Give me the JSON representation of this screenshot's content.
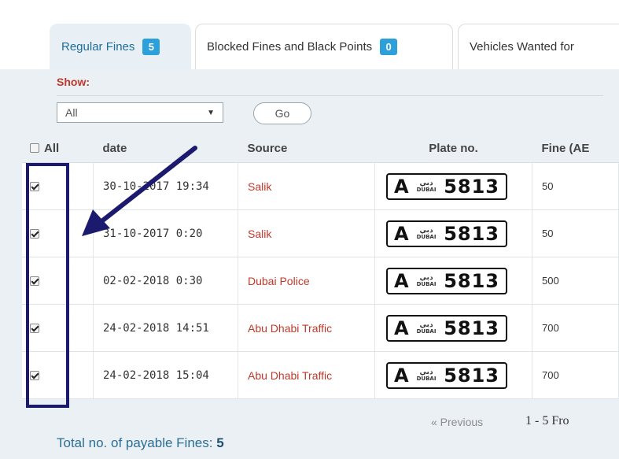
{
  "tabs": [
    {
      "label": "Regular Fines",
      "badge": "5",
      "active": true
    },
    {
      "label": "Blocked Fines and Black Points",
      "badge": "0",
      "active": false
    },
    {
      "label": "Vehicles Wanted for",
      "badge": "",
      "active": false
    }
  ],
  "filter": {
    "show_label": "Show:",
    "select_value": "All",
    "go_label": "Go"
  },
  "table": {
    "headers": {
      "all": "All",
      "date": "date",
      "source": "Source",
      "plate": "Plate no.",
      "fine": "Fine (AE"
    },
    "rows": [
      {
        "date": "30-10-2017 19:34",
        "source": "Salik",
        "plate": {
          "code": "A",
          "emirate_ar": "دبي",
          "emirate_en": "DUBAI",
          "number": "5813"
        },
        "fine": "50",
        "checked": true
      },
      {
        "date": "31-10-2017 0:20",
        "source": "Salik",
        "plate": {
          "code": "A",
          "emirate_ar": "دبي",
          "emirate_en": "DUBAI",
          "number": "5813"
        },
        "fine": "50",
        "checked": true
      },
      {
        "date": "02-02-2018 0:30",
        "source": "Dubai Police",
        "plate": {
          "code": "A",
          "emirate_ar": "دبي",
          "emirate_en": "DUBAI",
          "number": "5813"
        },
        "fine": "500",
        "checked": true
      },
      {
        "date": "24-02-2018 14:51",
        "source": "Abu Dhabi Traffic",
        "plate": {
          "code": "A",
          "emirate_ar": "دبي",
          "emirate_en": "DUBAI",
          "number": "5813"
        },
        "fine": "700",
        "checked": true
      },
      {
        "date": "24-02-2018 15:04",
        "source": "Abu Dhabi Traffic",
        "plate": {
          "code": "A",
          "emirate_ar": "دبي",
          "emirate_en": "DUBAI",
          "number": "5813"
        },
        "fine": "700",
        "checked": true
      }
    ]
  },
  "pager": {
    "previous": "« Previous",
    "range": "1 - 5  Fro"
  },
  "total": {
    "label": "Total no. of payable Fines:",
    "value": "5"
  },
  "colors": {
    "accent": "#2d9fd9",
    "source_red": "#c0392b",
    "annotation": "#1c1a6e"
  }
}
